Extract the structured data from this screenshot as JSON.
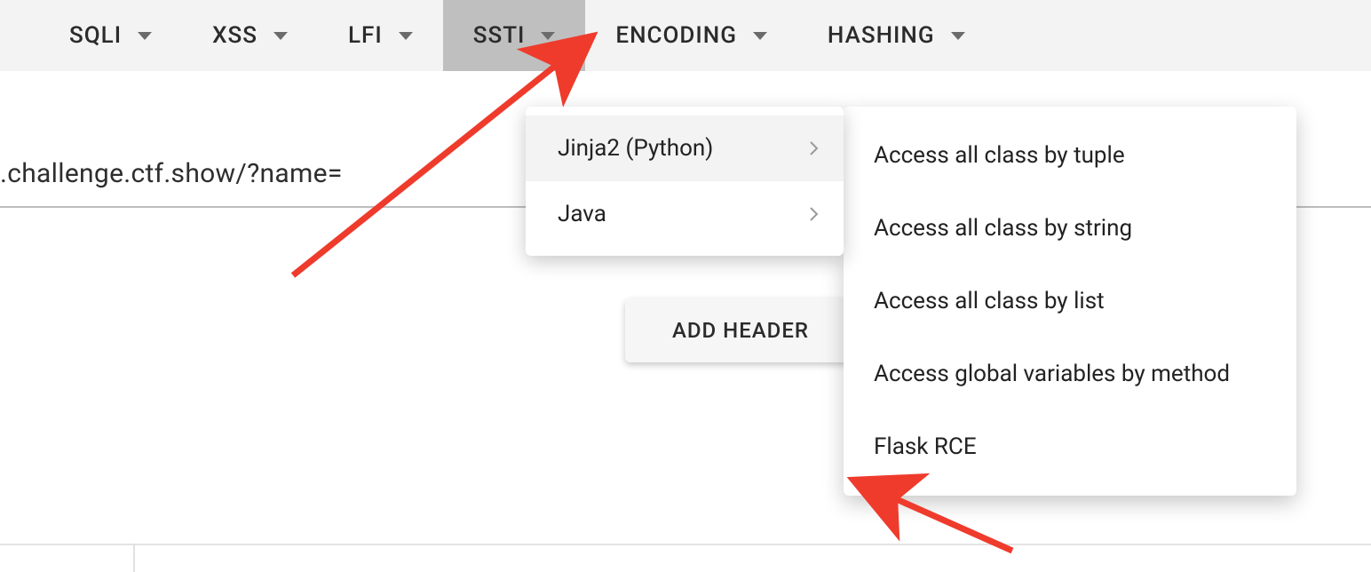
{
  "toolbar": {
    "items": [
      {
        "label": "SQLI"
      },
      {
        "label": "XSS"
      },
      {
        "label": "LFI"
      },
      {
        "label": "SSTI"
      },
      {
        "label": "ENCODING"
      },
      {
        "label": "HASHING"
      }
    ]
  },
  "url_field": {
    "value": ".challenge.ctf.show/?name="
  },
  "submenu_ssti": {
    "items": [
      {
        "label": "Jinja2 (Python)"
      },
      {
        "label": "Java"
      }
    ]
  },
  "submenu_jinja": {
    "items": [
      {
        "label": "Access all class by tuple"
      },
      {
        "label": "Access all class by string"
      },
      {
        "label": "Access all class by list"
      },
      {
        "label": "Access global variables by method"
      },
      {
        "label": "Flask RCE"
      }
    ]
  },
  "buttons": {
    "add_header": "ADD HEADER"
  }
}
